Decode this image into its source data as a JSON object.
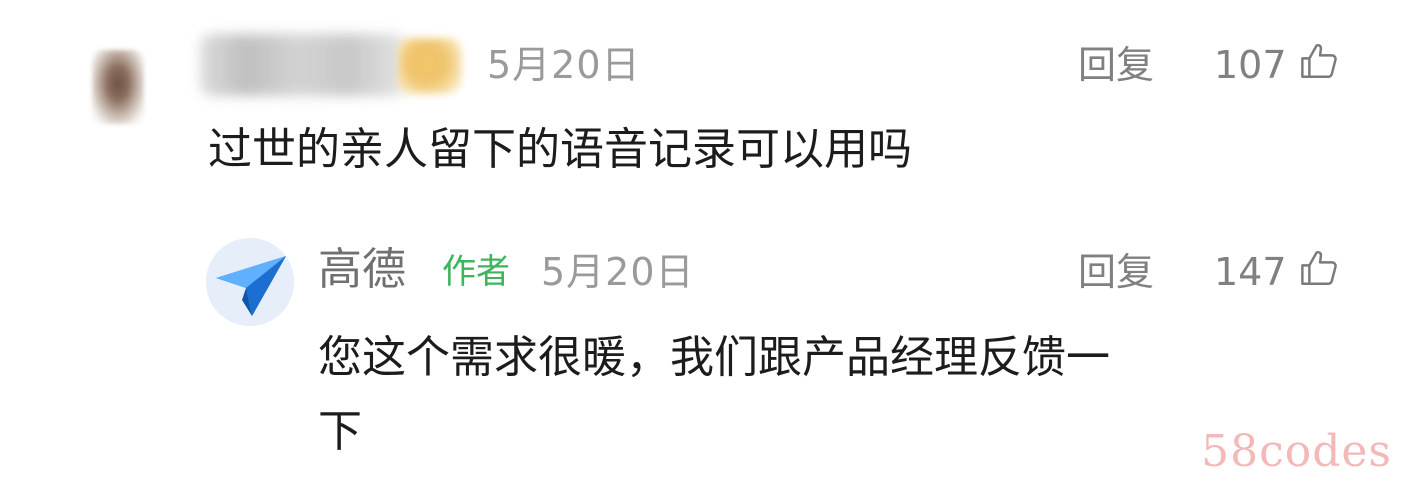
{
  "comment": {
    "user_name": "",
    "date": "5月20日",
    "reply_label": "回复",
    "like_count": "107",
    "content": "过世的亲人留下的语音记录可以用吗"
  },
  "reply": {
    "author_name": "高德",
    "author_tag": "作者",
    "date": "5月20日",
    "reply_label": "回复",
    "like_count": "147",
    "content_line1": "您这个需求很暖，我们跟产品经理反馈一",
    "content_line2": "下"
  },
  "watermark": "58codes",
  "icons": {
    "like": "thumbs-up-icon",
    "avatar": "paper-plane-icon"
  },
  "colors": {
    "author_tag": "#3cb55c",
    "meta_gray": "#9a9a9a",
    "text": "#1c1c1c",
    "watermark": "#f4b8b8"
  }
}
